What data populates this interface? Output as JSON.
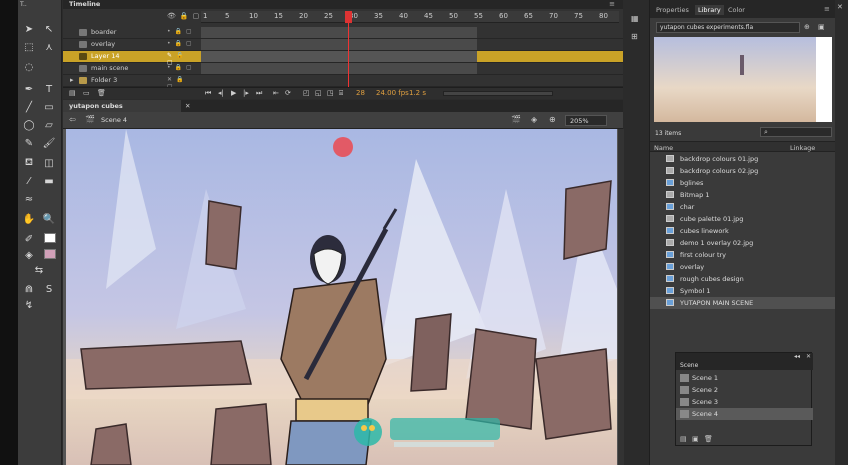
{
  "timeline": {
    "title": "Timeline",
    "ruler_ticks": [
      "1",
      "5",
      "10",
      "15",
      "20",
      "25",
      "30",
      "35",
      "40",
      "45",
      "50",
      "55",
      "60",
      "65",
      "70",
      "75",
      "80"
    ],
    "layers": [
      {
        "name": "boarder"
      },
      {
        "name": "overlay"
      },
      {
        "name": "Layer 14"
      },
      {
        "name": "main scene"
      },
      {
        "name": "Folder 3"
      }
    ],
    "current_frame": "28",
    "fps": "24.00 fps",
    "time": "1.2 s"
  },
  "document": {
    "tab_label": "yutapon cubes experiments.fla*",
    "scene_label": "Scene 4",
    "zoom": "205%"
  },
  "right_panel": {
    "tabs": [
      "Properties",
      "Library",
      "Color"
    ],
    "library_doc": "yutapon cubes experiments.fla",
    "items_count": "13 items",
    "column_name": "Name",
    "column_linkage": "Linkage",
    "items": [
      "backdrop colours 01.jpg",
      "backdrop colours 02.jpg",
      "bglines",
      "Bitmap 1",
      "char",
      "cube palette 01.jpg",
      "cubes linework",
      "demo 1 overlay 02.jpg",
      "first colour try",
      "overlay",
      "rough cubes design",
      "Symbol 1",
      "YUTAPON MAIN SCENE"
    ]
  },
  "scene_panel": {
    "title": "Scene",
    "scenes": [
      "Scene 1",
      "Scene 2",
      "Scene 3",
      "Scene 4"
    ]
  },
  "colors": {
    "accent_red": "#dd3333",
    "selected_layer": "#c9a227",
    "sky": "#a9b8e0"
  }
}
